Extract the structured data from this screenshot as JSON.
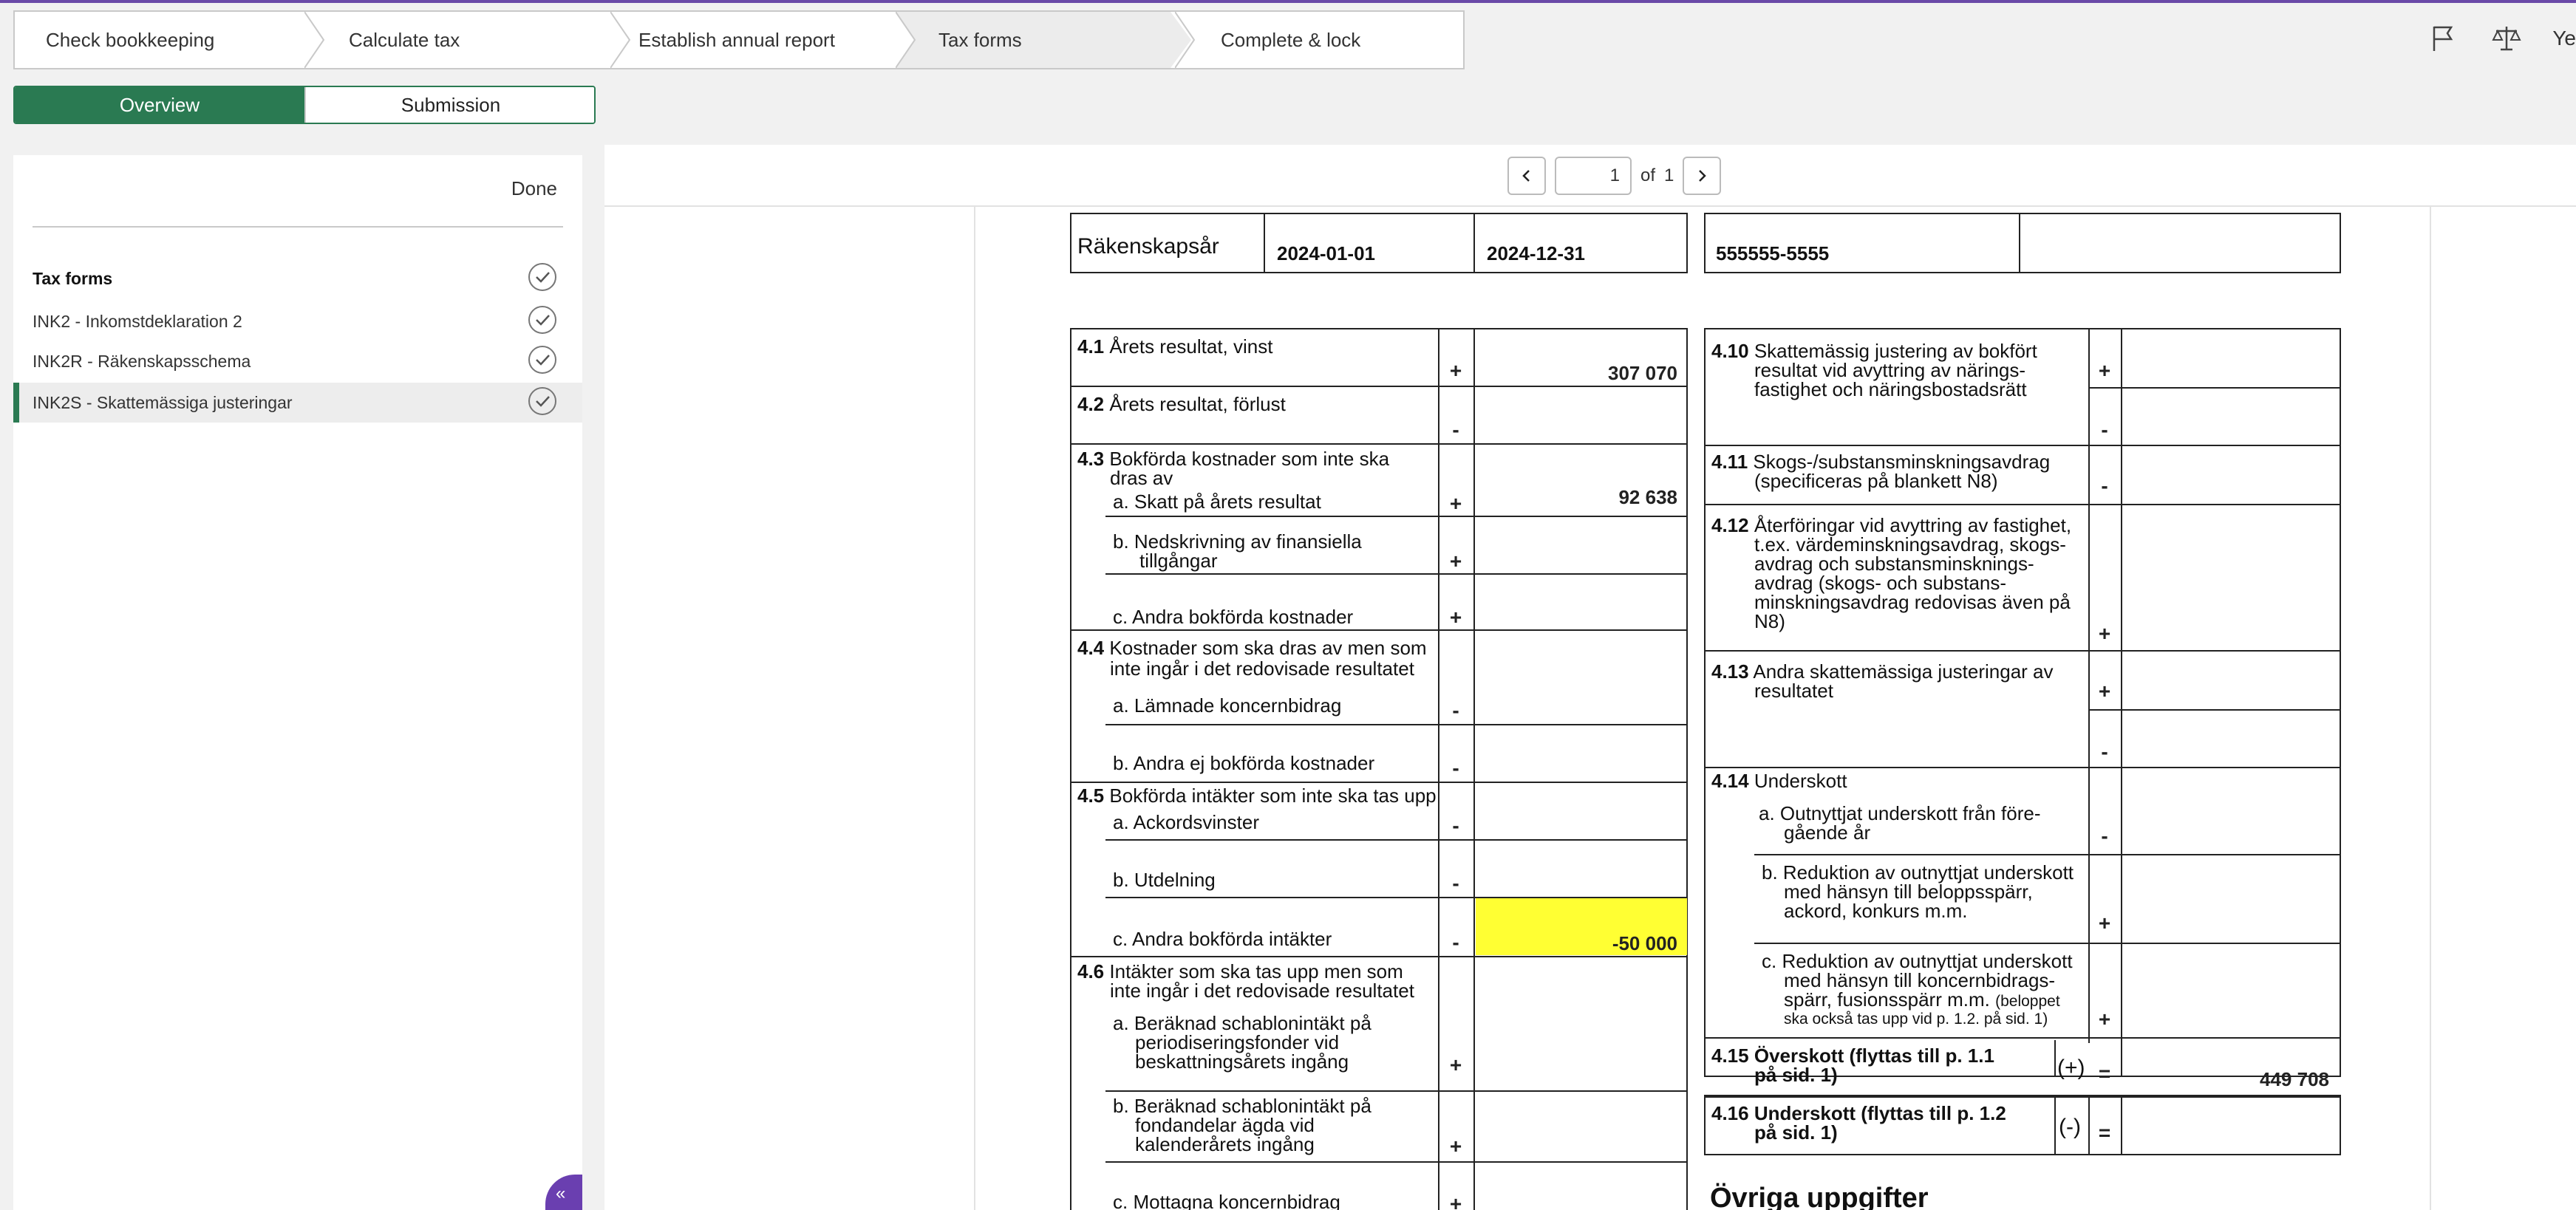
{
  "steps": [
    "Check bookkeeping",
    "Calculate tax",
    "Establish annual report",
    "Tax forms",
    "Complete & lock"
  ],
  "active_step": "Tax forms",
  "toolbar": {
    "user_truncated": "Ye"
  },
  "tabs": {
    "overview": "Overview",
    "submission": "Submission",
    "active": "Overview"
  },
  "left_panel": {
    "done": "Done",
    "heading": "Tax forms",
    "items": [
      {
        "label": "INK2 - Inkomstdeklaration 2"
      },
      {
        "label": "INK2R - Räkenskapsschema"
      },
      {
        "label": "INK2S - Skattemässiga justeringar"
      }
    ],
    "selected": "INK2S - Skattemässiga justeringar"
  },
  "pager": {
    "page": "1",
    "of_label": "of",
    "total": "1"
  },
  "form": {
    "header": {
      "label": "Räkenskapsår",
      "from": "2024-01-01",
      "to": "2024-12-31",
      "org": "555555-5555"
    },
    "left_rows": {
      "r41_num": "4.1",
      "r41_text": "Årets resultat, vinst",
      "r41_sign": "+",
      "r41_val": "307 070",
      "r42_num": "4.2",
      "r42_text": "Årets resultat, förlust",
      "r42_sign": "-",
      "r43_num": "4.3",
      "r43_text": "Bokförda kostnader som inte ska",
      "r43_text2": "dras av",
      "r43a": "a. Skatt på årets resultat",
      "r43a_sign": "+",
      "r43a_val": "92 638",
      "r43b": "b. Nedskrivning av finansiella",
      "r43b2": "tillgångar",
      "r43b_sign": "+",
      "r43c": "c. Andra bokförda kostnader",
      "r43c_sign": "+",
      "r44_num": "4.4",
      "r44_text": "Kostnader som ska dras av men som",
      "r44_text2": "inte ingår i det redovisade resultatet",
      "r44a": "a. Lämnade koncernbidrag",
      "r44a_sign": "-",
      "r44b": "b. Andra ej bokförda kostnader",
      "r44b_sign": "-",
      "r45_num": "4.5",
      "r45_text": "Bokförda intäkter som inte ska tas upp",
      "r45a": "a. Ackordsvinster",
      "r45a_sign": "-",
      "r45b": "b. Utdelning",
      "r45b_sign": "-",
      "r45c": "c. Andra bokförda intäkter",
      "r45c_sign": "-",
      "r45c_val": "-50 000",
      "r46_num": "4.6",
      "r46_text": "Intäkter som ska tas upp men som",
      "r46_text2": "inte ingår i det redovisade resultatet",
      "r46a": "a. Beräknad schablonintäkt på",
      "r46a2": "periodiseringsfonder vid",
      "r46a3": "beskattningsårets ingång",
      "r46a_sign": "+",
      "r46b": "b. Beräknad schablonintäkt på",
      "r46b2": "fondandelar ägda vid",
      "r46b3": "kalenderårets ingång",
      "r46b_sign": "+",
      "r46c": "c. Mottagna koncernbidrag",
      "r46c_sign": "+"
    },
    "right_rows": {
      "r410_num": "4.10",
      "r410_text": "Skattemässig justering av bokfört",
      "r410_text2": "resultat vid avyttring av närings-",
      "r410_text3": "fastighet och näringsbostadsrätt",
      "r410_sign_plus": "+",
      "r410_sign_minus": "-",
      "r411_num": "4.11",
      "r411_text": "Skogs-/substansminskningsavdrag",
      "r411_text2": "(specificeras på blankett N8)",
      "r411_sign": "-",
      "r412_num": "4.12",
      "r412_text": "Återföringar vid avyttring av fastighet,",
      "r412_text2": "t.ex. värdeminskningsavdrag, skogs-",
      "r412_text3": "avdrag och substansminsknings-",
      "r412_text4": "avdrag (skogs- och substans-",
      "r412_text5": "minskningsavdrag redovisas även på",
      "r412_text6": "N8)",
      "r412_sign": "+",
      "r413_num": "4.13",
      "r413_text": "Andra skattemässiga justeringar av",
      "r413_text2": "resultatet",
      "r413_sign_plus": "+",
      "r413_sign_minus": "-",
      "r414_num": "4.14",
      "r414_text": "Underskott",
      "r414a": "a. Outnyttjat underskott från före-",
      "r414a2": "gående år",
      "r414a_sign": "-",
      "r414b": "b. Reduktion av outnyttjat underskott",
      "r414b2": "med hänsyn till beloppsspärr,",
      "r414b3": "ackord, konkurs m.m.",
      "r414b_sign": "+",
      "r414c": "c. Reduktion av outnyttjat underskott",
      "r414c2": "med hänsyn till koncernbidrags-",
      "r414c3": "spärr, fusionsspärr m.m.",
      "r414c3b": "(beloppet",
      "r414c4": "ska också tas upp vid p. 1.2. på sid. 1)",
      "r414c_sign": "+",
      "r415_num": "4.15",
      "r415_text": "Överskott (flyttas till  p. 1.1",
      "r415_text2": "på sid. 1)",
      "r415_paren": "(+)",
      "r415_eq": "=",
      "r415_val": "449 708",
      "r416_num": "4.16",
      "r416_text": "Underskott (flyttas till  p. 1.2",
      "r416_text2": "på sid. 1)",
      "r416_paren": "(-)",
      "r416_eq": "=",
      "ovriga": "Övriga uppgifter"
    }
  },
  "colors": {
    "accent_green": "#2a7a52",
    "accent_purple": "#6a3fb0",
    "highlight_yellow": "#ffff33"
  }
}
